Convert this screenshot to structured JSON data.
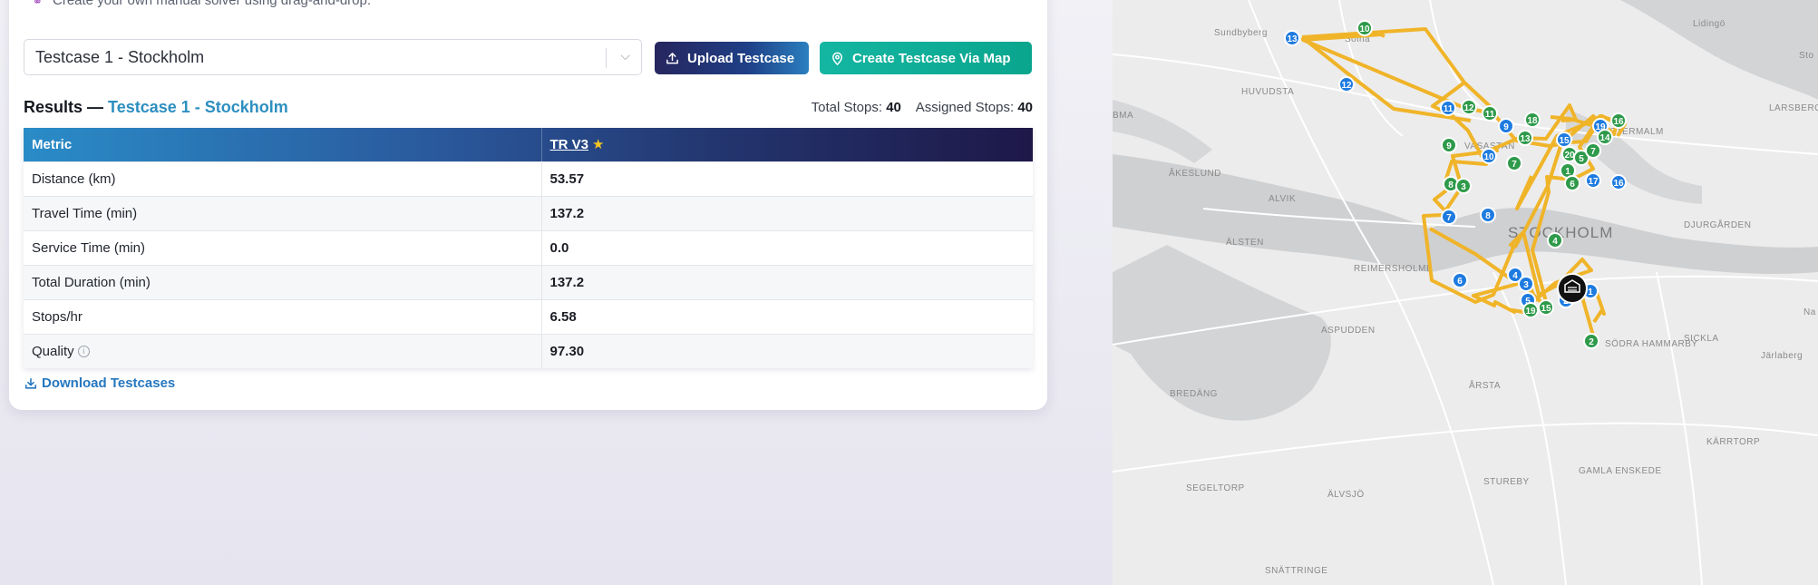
{
  "subtitle": "Create your own manual solver using drag-and-drop.",
  "testcase_select": {
    "value": "Testcase 1 - Stockholm"
  },
  "buttons": {
    "upload": "Upload Testcase",
    "create_map": "Create Testcase Via Map"
  },
  "results": {
    "prefix": "Results —",
    "testcase": "Testcase 1 - Stockholm",
    "total_stops_label": "Total Stops:",
    "total_stops": "40",
    "assigned_stops_label": "Assigned Stops:",
    "assigned_stops": "40"
  },
  "table": {
    "headers": {
      "metric": "Metric",
      "solver": "TR V3"
    },
    "rows": [
      {
        "metric": "Distance (km)",
        "value": "53.57"
      },
      {
        "metric": "Travel Time (min)",
        "value": "137.2"
      },
      {
        "metric": "Service Time (min)",
        "value": "0.0"
      },
      {
        "metric": "Total Duration (min)",
        "value": "137.2"
      },
      {
        "metric": "Stops/hr",
        "value": "6.58"
      },
      {
        "metric": "Quality",
        "value": "97.30"
      }
    ]
  },
  "download_link": "Download Testcases",
  "map": {
    "labels": {
      "sundbyberg": "Sundbyberg",
      "solna": "Solna",
      "huvudsta": "HUVUDSTA",
      "lidingo": "Lidingö",
      "sto": "Sto",
      "akeslund": "ÅKESLUND",
      "alvik": "ALVIK",
      "alsten": "ÄLSTEN",
      "reimersholme": "REIMERSHOLME",
      "stockholm": "STOCKHOLM",
      "djurgarden": "DJURGÅRDEN",
      "vasastan": "VASASTAN",
      "ostermalm": "ÖSTERMALM",
      "larsberg": "LARSBERG",
      "aspudden": "ASPUDDEN",
      "sodra_hammarby": "SÖDRA HAMMARBY",
      "sickla": "SICKLA",
      "na": "Na",
      "jarlaberg": "Järlaberg",
      "bredang": "BREDÄNG",
      "arsta": "ÅRSTA",
      "karrtorp": "KÄRRTORP",
      "segeltorp": "SEGELTORP",
      "alvsjo": "ÄLVSJÖ",
      "stureby": "STUREBY",
      "gamla_enskede": "GAMLA ENSKEDE",
      "snattringe": "SNÄTTRINGE",
      "bromma": "BMA"
    },
    "colors": {
      "route": "#f0b429",
      "blue_marker": "#1e7be0",
      "green_marker": "#2e9a4a",
      "depot": "#111111"
    },
    "markers": [
      {
        "n": "13",
        "color": "blue"
      },
      {
        "n": "10",
        "color": "green"
      },
      {
        "n": "12",
        "color": "blue"
      },
      {
        "n": "11",
        "color": "blue"
      },
      {
        "n": "12",
        "color": "green"
      },
      {
        "n": "11",
        "color": "green"
      },
      {
        "n": "9",
        "color": "green"
      },
      {
        "n": "9",
        "color": "blue"
      },
      {
        "n": "10",
        "color": "blue"
      },
      {
        "n": "18",
        "color": "green"
      },
      {
        "n": "13",
        "color": "green"
      },
      {
        "n": "7",
        "color": "green"
      },
      {
        "n": "15",
        "color": "blue"
      },
      {
        "n": "20",
        "color": "green"
      },
      {
        "n": "5",
        "color": "green"
      },
      {
        "n": "7",
        "color": "green"
      },
      {
        "n": "1",
        "color": "green"
      },
      {
        "n": "6",
        "color": "green"
      },
      {
        "n": "17",
        "color": "blue"
      },
      {
        "n": "16",
        "color": "blue"
      },
      {
        "n": "19",
        "color": "blue"
      },
      {
        "n": "16",
        "color": "green"
      },
      {
        "n": "14",
        "color": "green"
      },
      {
        "n": "8",
        "color": "green"
      },
      {
        "n": "3",
        "color": "green"
      },
      {
        "n": "7",
        "color": "blue"
      },
      {
        "n": "8",
        "color": "blue"
      },
      {
        "n": "4",
        "color": "green"
      },
      {
        "n": "6",
        "color": "blue"
      },
      {
        "n": "4",
        "color": "blue"
      },
      {
        "n": "3",
        "color": "blue"
      },
      {
        "n": "5",
        "color": "blue"
      },
      {
        "n": "19",
        "color": "green"
      },
      {
        "n": "15",
        "color": "green"
      },
      {
        "n": "2",
        "color": "blue"
      },
      {
        "n": "1",
        "color": "blue"
      },
      {
        "n": "2",
        "color": "green"
      }
    ]
  }
}
